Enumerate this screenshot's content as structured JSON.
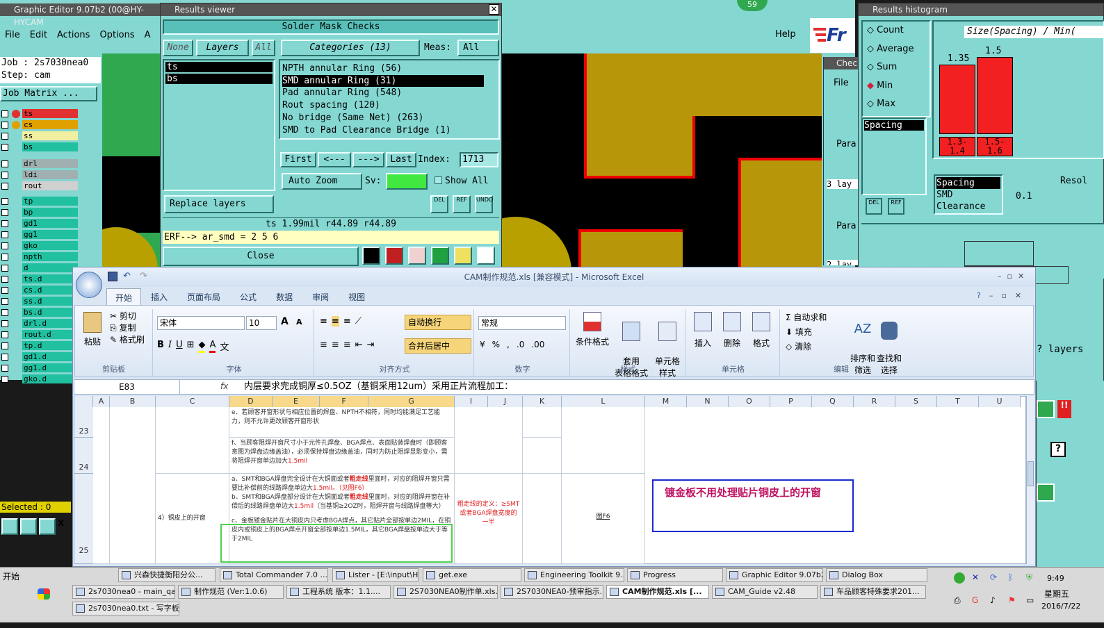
{
  "graphic_editor": {
    "title": "Graphic Editor 9.07b2 (00@HY-HYCAM",
    "menu": [
      "File",
      "Edit",
      "Actions",
      "Options",
      "A"
    ],
    "help": "Help",
    "job_label": "Job :",
    "job": "2s7030nea0",
    "step_label": "Step:",
    "step": "cam",
    "job_matrix": "Job Matrix ...",
    "selected": "Selected : 0",
    "badge": "59",
    "logo": "Fr",
    "layers": [
      {
        "name": "ts",
        "c": "#e03030"
      },
      {
        "name": "cs",
        "c": "#e0a000"
      },
      {
        "name": "ss",
        "c": "#f0f0a0"
      },
      {
        "name": "bs",
        "c": "#20c0a0"
      },
      {
        "name": "drl",
        "c": "#a0b0b0"
      },
      {
        "name": "ldi",
        "c": "#a0b0b0"
      },
      {
        "name": "rout",
        "c": "#d0d0d0"
      },
      {
        "name": "tp",
        "c": "#20c0a0"
      },
      {
        "name": "bp",
        "c": "#20c0a0"
      },
      {
        "name": "gd1",
        "c": "#20c0a0"
      },
      {
        "name": "gg1",
        "c": "#20c0a0"
      },
      {
        "name": "gko",
        "c": "#20c0a0"
      },
      {
        "name": "npth",
        "c": "#20c0a0"
      },
      {
        "name": "d",
        "c": "#20c0a0"
      },
      {
        "name": "ts.d",
        "c": "#20c0a0"
      },
      {
        "name": "cs.d",
        "c": "#20c0a0"
      },
      {
        "name": "ss.d",
        "c": "#20c0a0"
      },
      {
        "name": "bs.d",
        "c": "#20c0a0"
      },
      {
        "name": "drl.d",
        "c": "#20c0a0"
      },
      {
        "name": "rout.d",
        "c": "#20c0a0"
      },
      {
        "name": "tp.d",
        "c": "#20c0a0"
      },
      {
        "name": "gd1.d",
        "c": "#20c0a0"
      },
      {
        "name": "gg1.d",
        "c": "#20c0a0"
      },
      {
        "name": "gko.d",
        "c": "#20c0a0"
      }
    ]
  },
  "results_viewer": {
    "title": "Results viewer",
    "heading": "Solder Mask Checks",
    "none": "None",
    "layers": "Layers",
    "all": "All",
    "categories": "Categories (13)",
    "meas": "Meas:",
    "meas_val": "All",
    "layer_items": [
      "ts",
      "bs"
    ],
    "cat_items": [
      "NPTH annular Ring (56)",
      "SMD annular Ring (31)",
      "Pad annular Ring (548)",
      "Rout spacing (120)",
      "No bridge (Same Net) (263)",
      "SMD to Pad Clearance Bridge (1)"
    ],
    "first": "First",
    "prev": "<---",
    "next": "--->",
    "last": "Last",
    "index_label": "Index:",
    "index": "1713",
    "auto_zoom": "Auto Zoom",
    "sv": "Sv:",
    "show_all": "Show All",
    "replace": "Replace layers",
    "status": "ts 1.99mil   r44.89   r44.89",
    "erf": "ERF--> ar_smd = 2 5 6",
    "close": "Close",
    "del": "DEL",
    "ref": "REF",
    "undo": "UNDO"
  },
  "histogram": {
    "title": "Results histogram",
    "options": [
      "Count",
      "Average",
      "Sum",
      "Min",
      "Max"
    ],
    "selected": "Min",
    "header": "Size(Spacing) / Min(",
    "bars": [
      {
        "label": "1.3-\n1.4",
        "value": 1.35
      },
      {
        "label": "1.5-\n1.6",
        "value": 1.5
      }
    ],
    "list1": [
      "Spacing"
    ],
    "list2": [
      "Spacing",
      "SMD",
      "Clearance"
    ],
    "resol": "Resol",
    "resol_val": "0.1",
    "layers_text": "? layers"
  },
  "checks": {
    "title": "Chec",
    "file": "File",
    "para": "Para",
    "lay": "3 lay",
    "lay2": "2 lay"
  },
  "excel": {
    "title": "CAM制作规范.xls  [兼容模式] - Microsoft Excel",
    "tabs": [
      "开始",
      "插入",
      "页面布局",
      "公式",
      "数据",
      "审阅",
      "视图"
    ],
    "clipboard": {
      "paste": "粘贴",
      "cut": "剪切",
      "copy": "复制",
      "format": "格式刷",
      "label": "剪贴板"
    },
    "font": {
      "name": "宋体",
      "size": "10",
      "label": "字体"
    },
    "align": {
      "wrap": "自动换行",
      "merge": "合并后居中",
      "label": "对齐方式"
    },
    "number": {
      "format": "常规",
      "label": "数字"
    },
    "styles": {
      "cond": "条件格式",
      "table": "套用\n表格格式",
      "cell": "单元格\n样式",
      "label": "样式"
    },
    "cells": {
      "insert": "插入",
      "delete": "删除",
      "format": "格式",
      "label": "单元格"
    },
    "editing": {
      "sum": "自动求和",
      "fill": "填充",
      "clear": "清除",
      "sort": "排序和\n筛选",
      "find": "查找和\n选择",
      "label": "编辑"
    },
    "namebox": "E83",
    "fx": "fx",
    "formula": "内层要求完成铜厚≤0.5OZ（基铜采用12um）采用正片流程加工：",
    "cols": [
      "A",
      "B",
      "C",
      "D",
      "E",
      "F",
      "G",
      "I",
      "J",
      "K",
      "L",
      "M",
      "N",
      "O",
      "P",
      "Q",
      "R",
      "S",
      "T",
      "U"
    ],
    "rows": [
      "23",
      "24",
      "25"
    ],
    "cell_d23": "e、若顾客开窗形状与相应位置的焊盘、NPTH不相符，同时均能满足工艺能力，则不允许更改顾客开窗形状",
    "cell_d24a": "f、当顾客阻焊开窗尺寸小于元件孔焊盘、BGA焊点、表面贴装焊盘时（即顾客意图为焊盘边缘盖油），必须保持焊盘边缘盖油，同时为防止阻焊显影变小，需将阻焊开窗单边加大",
    "cell_d24b": "1.5mil",
    "cell_c25": "4）铜皮上的开窗",
    "cell_d25a": "a、SMT和BGA焊盘完全设计在大铜面或者",
    "cell_d25b": "粗走线",
    "cell_d25c": "里面时，对应的阻焊开窗只需要比补偿前的线路焊盘单边大",
    "cell_d25d": "1.5mil。（见图F6）",
    "cell_d25e": "b、SMT和BGA焊盘部分设计在大铜面或者",
    "cell_d25f": "粗走线",
    "cell_d25g": "里面时，对应的阻焊开窗在补偿后的线路焊盘单边大",
    "cell_d25h": "1.5mil",
    "cell_d25i": "（当基铜≥2OZ时，阻焊开窗与线路焊盘等大）",
    "cell_d25j": "c、金板镀金贴片在大铜皮内只考虑BGA焊点，其它贴片全部按单边2MIL，在铜皮内或铜皮上的BGA焊点开窗全部按单边1.5MIL，其它BGA焊盘按单边大于等于2MIL",
    "cell_g25": "粗走线的定义：≥SMT或者BGA焊盘宽度的一半",
    "cell_l25": "图F6",
    "note": "镀金板不用处理贴片铜皮上的开窗"
  },
  "taskbar": {
    "start": "开始",
    "row1": [
      "兴森快捷衡阳分公...",
      "Total Commander 7.0 ...",
      "Lister - [E:\\input\\HKF...",
      "get.exe",
      "Engineering Toolkit 9....",
      "Progress",
      "Graphic Editor 9.07b2 ...",
      "Dialog Box"
    ],
    "row2": [
      "2s7030nea0 - main_qa",
      "制作规范 (Ver:1.0.6)",
      "工程系统  版本：1.1....",
      "2S7030NEA0制作单.xls...",
      "2S7030NEA0-预审指示...",
      "CAM制作规范.xls  [...",
      "CAM_Guide v2.48",
      "车品顾客特殊要求201..."
    ],
    "row3": [
      "2s7030nea0.txt - 写字板"
    ],
    "time": "9:49",
    "day": "星期五",
    "date": "2016/7/22"
  }
}
